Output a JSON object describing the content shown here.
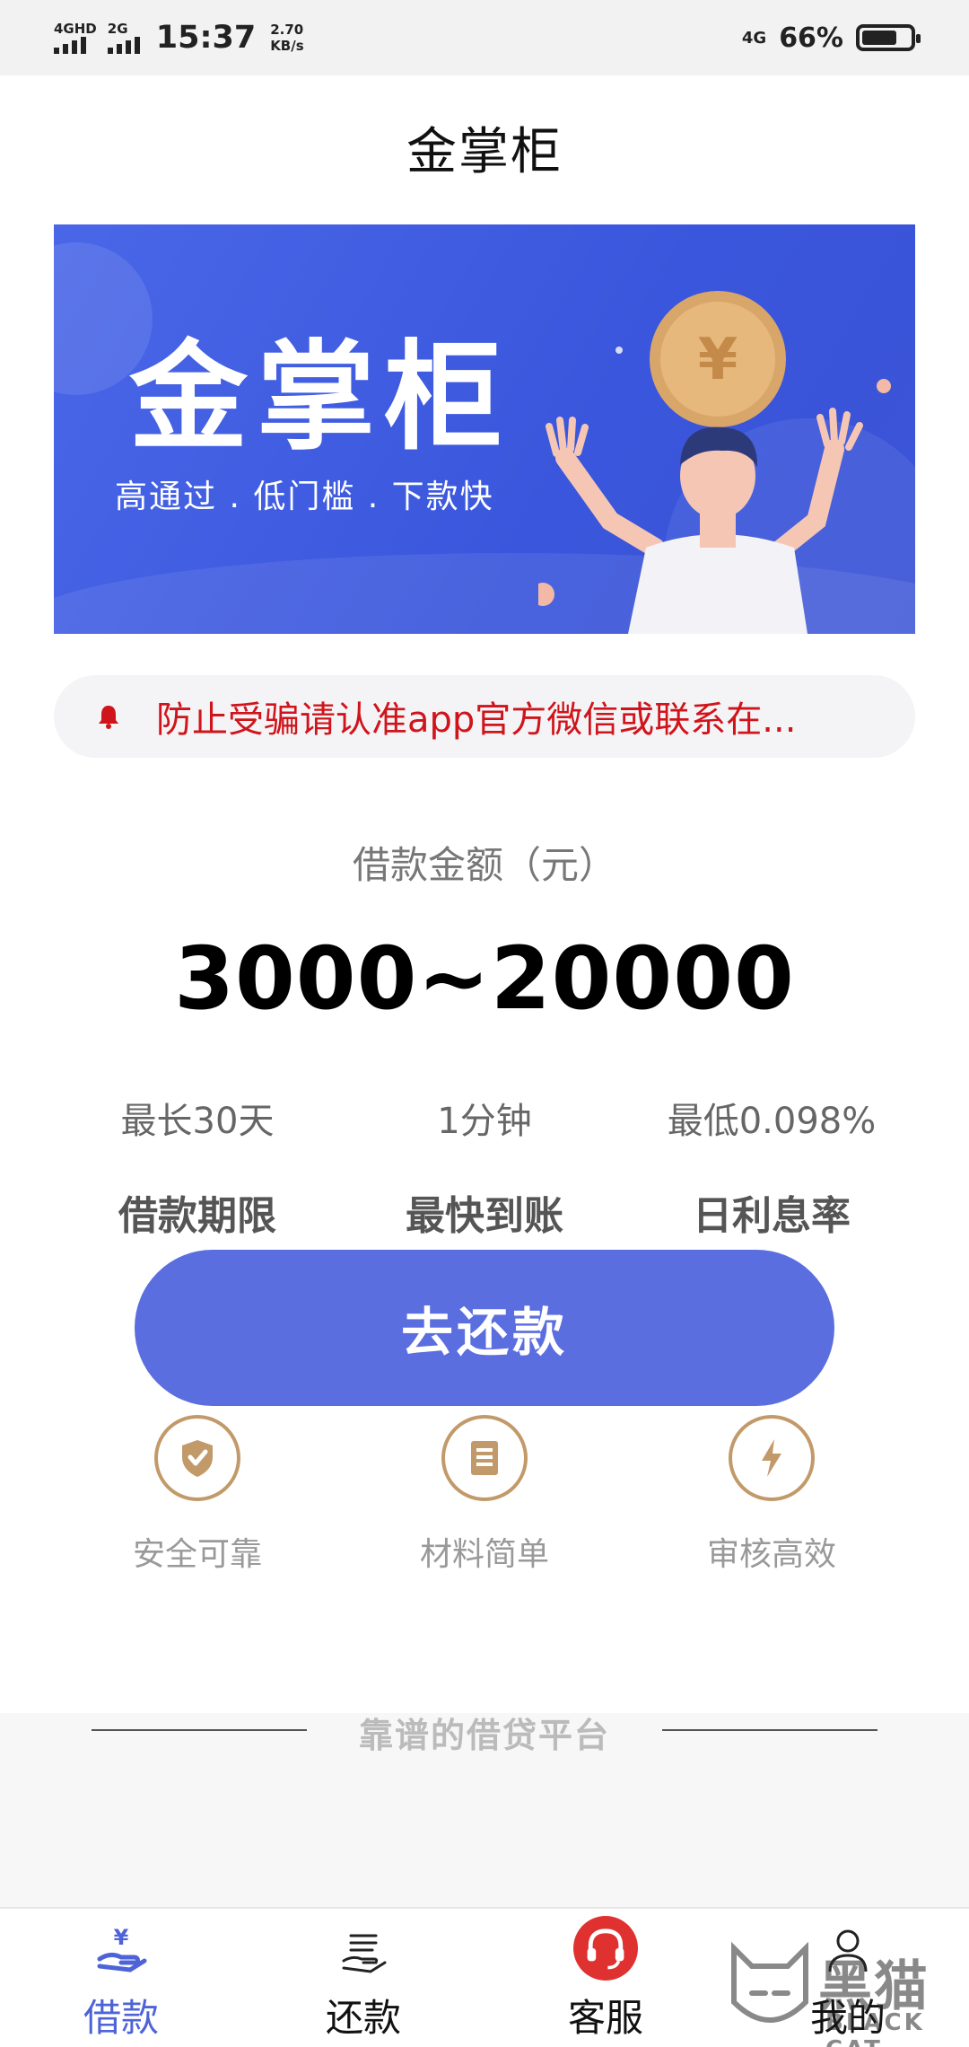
{
  "status_bar": {
    "net1": "4GHD",
    "net2": "2G",
    "time": "15:37",
    "speed_value": "2.70",
    "speed_unit": "KB/s",
    "net_right": "4G",
    "battery": "66%"
  },
  "header": {
    "title": "金掌柜"
  },
  "banner": {
    "title": "金掌柜",
    "subtitle": "高通过 . 低门槛 . 下款快",
    "coin_symbol": "¥"
  },
  "notice": {
    "text": "防止受骗请认准app官方微信或联系在..."
  },
  "loan": {
    "label": "借款金额（元）",
    "amount": "3000~20000",
    "stats": [
      {
        "value": "最长30天",
        "key": "借款期限"
      },
      {
        "value": "1分钟",
        "key": "最快到账"
      },
      {
        "value": "最低0.098%",
        "key": "日利息率"
      }
    ]
  },
  "cta": {
    "label": "去还款"
  },
  "features": [
    {
      "label": "安全可靠",
      "icon": "shield-icon"
    },
    {
      "label": "材料简单",
      "icon": "document-icon"
    },
    {
      "label": "审核高效",
      "icon": "lightning-icon"
    }
  ],
  "tagline": "靠谱的借贷平台",
  "tabs": [
    {
      "label": "借款",
      "icon": "loan-hand-icon",
      "active": true
    },
    {
      "label": "还款",
      "icon": "repay-list-icon",
      "active": false
    },
    {
      "label": "客服",
      "icon": "headset-icon",
      "active": false
    },
    {
      "label": "我的",
      "icon": "user-icon",
      "active": false
    }
  ],
  "watermark": {
    "text": "黑猫",
    "sub": "BLACK CAT"
  },
  "colors": {
    "primary": "#5a6ee0",
    "banner": "#3b57dc",
    "notice_red": "#d0141b",
    "feature_gold": "#c29a6a",
    "tab_active": "#4e63d7",
    "headset_red": "#e03131"
  }
}
